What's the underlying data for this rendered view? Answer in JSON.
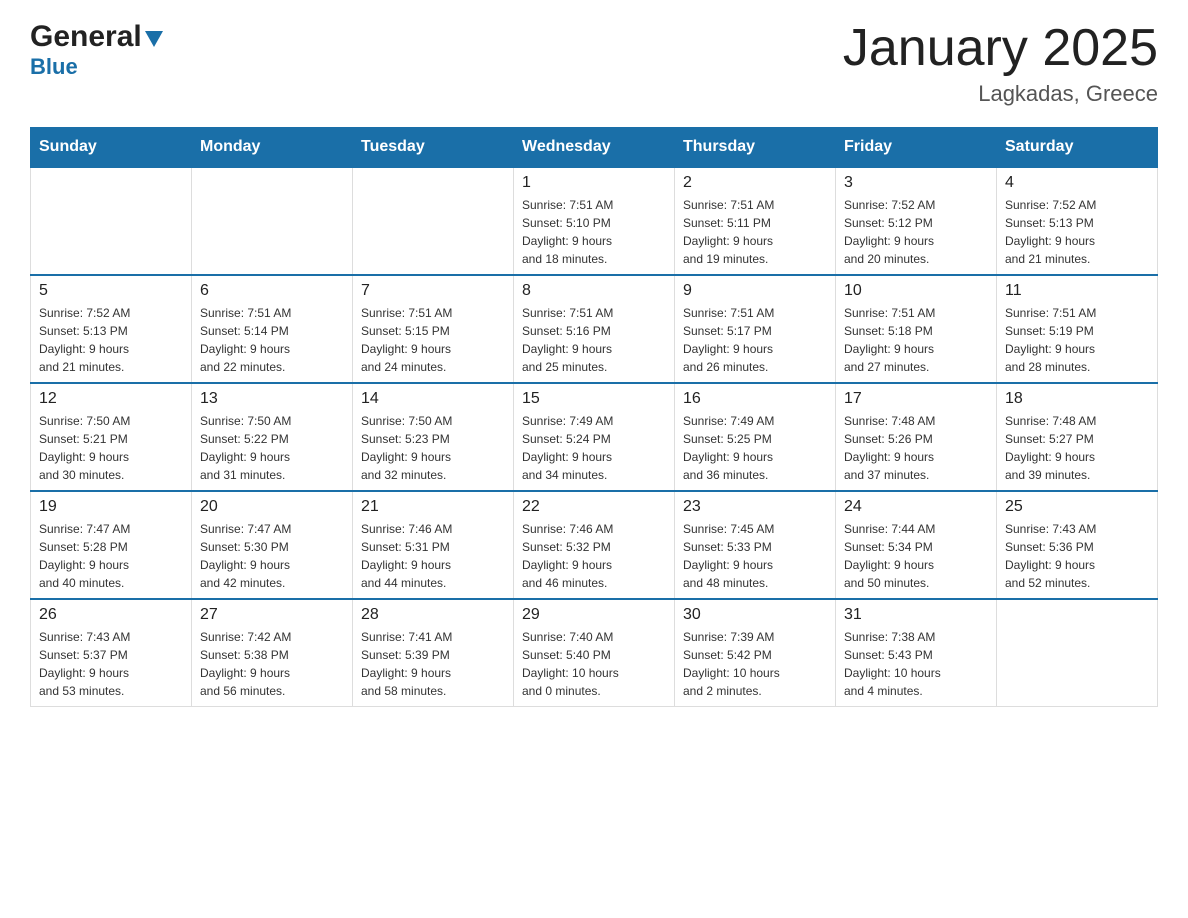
{
  "header": {
    "logo_general": "General",
    "logo_blue": "Blue",
    "title": "January 2025",
    "location": "Lagkadas, Greece"
  },
  "days_of_week": [
    "Sunday",
    "Monday",
    "Tuesday",
    "Wednesday",
    "Thursday",
    "Friday",
    "Saturday"
  ],
  "weeks": [
    [
      {
        "day": "",
        "info": ""
      },
      {
        "day": "",
        "info": ""
      },
      {
        "day": "",
        "info": ""
      },
      {
        "day": "1",
        "info": "Sunrise: 7:51 AM\nSunset: 5:10 PM\nDaylight: 9 hours\nand 18 minutes."
      },
      {
        "day": "2",
        "info": "Sunrise: 7:51 AM\nSunset: 5:11 PM\nDaylight: 9 hours\nand 19 minutes."
      },
      {
        "day": "3",
        "info": "Sunrise: 7:52 AM\nSunset: 5:12 PM\nDaylight: 9 hours\nand 20 minutes."
      },
      {
        "day": "4",
        "info": "Sunrise: 7:52 AM\nSunset: 5:13 PM\nDaylight: 9 hours\nand 21 minutes."
      }
    ],
    [
      {
        "day": "5",
        "info": "Sunrise: 7:52 AM\nSunset: 5:13 PM\nDaylight: 9 hours\nand 21 minutes."
      },
      {
        "day": "6",
        "info": "Sunrise: 7:51 AM\nSunset: 5:14 PM\nDaylight: 9 hours\nand 22 minutes."
      },
      {
        "day": "7",
        "info": "Sunrise: 7:51 AM\nSunset: 5:15 PM\nDaylight: 9 hours\nand 24 minutes."
      },
      {
        "day": "8",
        "info": "Sunrise: 7:51 AM\nSunset: 5:16 PM\nDaylight: 9 hours\nand 25 minutes."
      },
      {
        "day": "9",
        "info": "Sunrise: 7:51 AM\nSunset: 5:17 PM\nDaylight: 9 hours\nand 26 minutes."
      },
      {
        "day": "10",
        "info": "Sunrise: 7:51 AM\nSunset: 5:18 PM\nDaylight: 9 hours\nand 27 minutes."
      },
      {
        "day": "11",
        "info": "Sunrise: 7:51 AM\nSunset: 5:19 PM\nDaylight: 9 hours\nand 28 minutes."
      }
    ],
    [
      {
        "day": "12",
        "info": "Sunrise: 7:50 AM\nSunset: 5:21 PM\nDaylight: 9 hours\nand 30 minutes."
      },
      {
        "day": "13",
        "info": "Sunrise: 7:50 AM\nSunset: 5:22 PM\nDaylight: 9 hours\nand 31 minutes."
      },
      {
        "day": "14",
        "info": "Sunrise: 7:50 AM\nSunset: 5:23 PM\nDaylight: 9 hours\nand 32 minutes."
      },
      {
        "day": "15",
        "info": "Sunrise: 7:49 AM\nSunset: 5:24 PM\nDaylight: 9 hours\nand 34 minutes."
      },
      {
        "day": "16",
        "info": "Sunrise: 7:49 AM\nSunset: 5:25 PM\nDaylight: 9 hours\nand 36 minutes."
      },
      {
        "day": "17",
        "info": "Sunrise: 7:48 AM\nSunset: 5:26 PM\nDaylight: 9 hours\nand 37 minutes."
      },
      {
        "day": "18",
        "info": "Sunrise: 7:48 AM\nSunset: 5:27 PM\nDaylight: 9 hours\nand 39 minutes."
      }
    ],
    [
      {
        "day": "19",
        "info": "Sunrise: 7:47 AM\nSunset: 5:28 PM\nDaylight: 9 hours\nand 40 minutes."
      },
      {
        "day": "20",
        "info": "Sunrise: 7:47 AM\nSunset: 5:30 PM\nDaylight: 9 hours\nand 42 minutes."
      },
      {
        "day": "21",
        "info": "Sunrise: 7:46 AM\nSunset: 5:31 PM\nDaylight: 9 hours\nand 44 minutes."
      },
      {
        "day": "22",
        "info": "Sunrise: 7:46 AM\nSunset: 5:32 PM\nDaylight: 9 hours\nand 46 minutes."
      },
      {
        "day": "23",
        "info": "Sunrise: 7:45 AM\nSunset: 5:33 PM\nDaylight: 9 hours\nand 48 minutes."
      },
      {
        "day": "24",
        "info": "Sunrise: 7:44 AM\nSunset: 5:34 PM\nDaylight: 9 hours\nand 50 minutes."
      },
      {
        "day": "25",
        "info": "Sunrise: 7:43 AM\nSunset: 5:36 PM\nDaylight: 9 hours\nand 52 minutes."
      }
    ],
    [
      {
        "day": "26",
        "info": "Sunrise: 7:43 AM\nSunset: 5:37 PM\nDaylight: 9 hours\nand 53 minutes."
      },
      {
        "day": "27",
        "info": "Sunrise: 7:42 AM\nSunset: 5:38 PM\nDaylight: 9 hours\nand 56 minutes."
      },
      {
        "day": "28",
        "info": "Sunrise: 7:41 AM\nSunset: 5:39 PM\nDaylight: 9 hours\nand 58 minutes."
      },
      {
        "day": "29",
        "info": "Sunrise: 7:40 AM\nSunset: 5:40 PM\nDaylight: 10 hours\nand 0 minutes."
      },
      {
        "day": "30",
        "info": "Sunrise: 7:39 AM\nSunset: 5:42 PM\nDaylight: 10 hours\nand 2 minutes."
      },
      {
        "day": "31",
        "info": "Sunrise: 7:38 AM\nSunset: 5:43 PM\nDaylight: 10 hours\nand 4 minutes."
      },
      {
        "day": "",
        "info": ""
      }
    ]
  ]
}
